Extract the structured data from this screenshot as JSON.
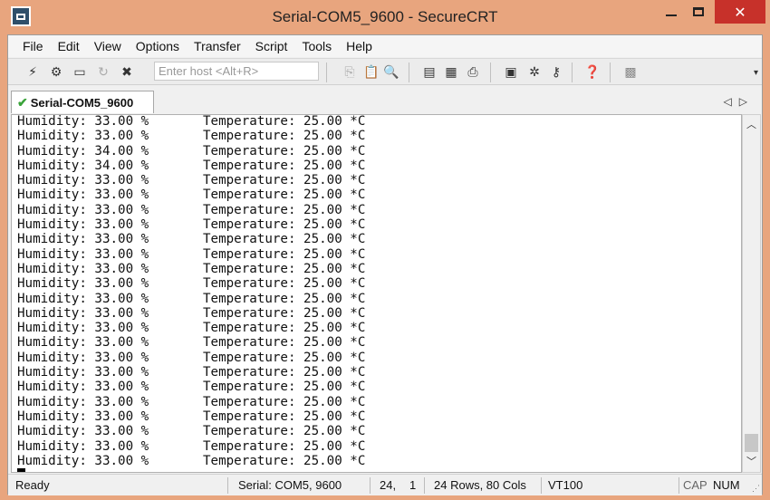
{
  "window": {
    "title": "Serial-COM5_9600 - SecureCRT",
    "close_glyph": "✕"
  },
  "menu": [
    "File",
    "Edit",
    "View",
    "Options",
    "Transfer",
    "Script",
    "Tools",
    "Help"
  ],
  "toolbar": {
    "host_placeholder": "Enter host <Alt+R>"
  },
  "tabs": [
    {
      "label": "Serial-COM5_9600",
      "status": "connected"
    }
  ],
  "tab_nav": {
    "prev": "◁",
    "next": "▷"
  },
  "terminal": {
    "lines": [
      "Humidity: 33.00 %       Temperature: 25.00 *C",
      "Humidity: 33.00 %       Temperature: 25.00 *C",
      "Humidity: 34.00 %       Temperature: 25.00 *C",
      "Humidity: 34.00 %       Temperature: 25.00 *C",
      "Humidity: 33.00 %       Temperature: 25.00 *C",
      "Humidity: 33.00 %       Temperature: 25.00 *C",
      "Humidity: 33.00 %       Temperature: 25.00 *C",
      "Humidity: 33.00 %       Temperature: 25.00 *C",
      "Humidity: 33.00 %       Temperature: 25.00 *C",
      "Humidity: 33.00 %       Temperature: 25.00 *C",
      "Humidity: 33.00 %       Temperature: 25.00 *C",
      "Humidity: 33.00 %       Temperature: 25.00 *C",
      "Humidity: 33.00 %       Temperature: 25.00 *C",
      "Humidity: 33.00 %       Temperature: 25.00 *C",
      "Humidity: 33.00 %       Temperature: 25.00 *C",
      "Humidity: 33.00 %       Temperature: 25.00 *C",
      "Humidity: 33.00 %       Temperature: 25.00 *C",
      "Humidity: 33.00 %       Temperature: 25.00 *C",
      "Humidity: 33.00 %       Temperature: 25.00 *C",
      "Humidity: 33.00 %       Temperature: 25.00 *C",
      "Humidity: 33.00 %       Temperature: 25.00 *C",
      "Humidity: 33.00 %       Temperature: 25.00 *C",
      "Humidity: 33.00 %       Temperature: 25.00 *C",
      "Humidity: 33.00 %       Temperature: 25.00 *C"
    ]
  },
  "status": {
    "state": "Ready",
    "connection": "Serial: COM5, 9600",
    "row": "24,",
    "col": "1",
    "size": "24 Rows,  80 Cols",
    "emulation": "VT100",
    "cap": "CAP",
    "num": "NUM"
  },
  "colors": {
    "window_frame": "#e8a57e",
    "close_button": "#c7312a",
    "connected_check": "#3aa33a"
  }
}
